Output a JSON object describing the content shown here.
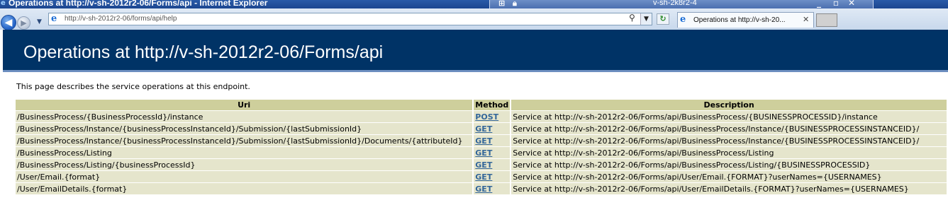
{
  "window": {
    "title": "Operations at http://v-sh-2012r2-06/Forms/api - Internet Explorer",
    "rdp_host": "v-sh-2k8r2-4"
  },
  "browser": {
    "address": "http://v-sh-2012r2-06/forms/api/help",
    "tab_label": "Operations at http://v-sh-20...",
    "icons": [
      "back-arrow-icon",
      "forward-arrow-icon",
      "ie-logo-icon",
      "search-icon",
      "refresh-icon",
      "close-icon"
    ]
  },
  "page": {
    "title": "Operations at http://v-sh-2012r2-06/Forms/api",
    "intro": "This page describes the service operations at this endpoint.",
    "header_color": "#003366",
    "table_header_color": "#cecf9c",
    "table_row_color": "#e5e5cc",
    "link_color": "#336699"
  },
  "table": {
    "headers": {
      "uri": "Uri",
      "method": "Method",
      "description": "Description"
    },
    "rows": [
      {
        "uri": "/BusinessProcess/{BusinessProcessId}/instance",
        "method": "POST",
        "description": "Service at http://v-sh-2012r2-06/Forms/api/BusinessProcess/{BUSINESSPROCESSID}/instance"
      },
      {
        "uri": "/BusinessProcess/Instance/{businessProcessInstanceId}/Submission/{lastSubmissionId}",
        "method": "GET",
        "description": "Service at http://v-sh-2012r2-06/Forms/api/BusinessProcess/Instance/{BUSINESSPROCESSINSTANCEID}/"
      },
      {
        "uri": "/BusinessProcess/Instance/{businessProcessInstanceId}/Submission/{lastSubmissionId}/Documents/{attributeId}",
        "method": "GET",
        "description": "Service at http://v-sh-2012r2-06/Forms/api/BusinessProcess/Instance/{BUSINESSPROCESSINSTANCEID}/"
      },
      {
        "uri": "/BusinessProcess/Listing",
        "method": "GET",
        "description": "Service at http://v-sh-2012r2-06/Forms/api/BusinessProcess/Listing"
      },
      {
        "uri": "/BusinessProcess/Listing/{businessProcessId}",
        "method": "GET",
        "description": "Service at http://v-sh-2012r2-06/Forms/api/BusinessProcess/Listing/{BUSINESSPROCESSID}"
      },
      {
        "uri": "/User/Email.{format}",
        "method": "GET",
        "description": "Service at http://v-sh-2012r2-06/Forms/api/User/Email.{FORMAT}?userNames={USERNAMES}"
      },
      {
        "uri": "/User/EmailDetails.{format}",
        "method": "GET",
        "description": "Service at http://v-sh-2012r2-06/Forms/api/User/EmailDetails.{FORMAT}?userNames={USERNAMES}"
      }
    ]
  }
}
